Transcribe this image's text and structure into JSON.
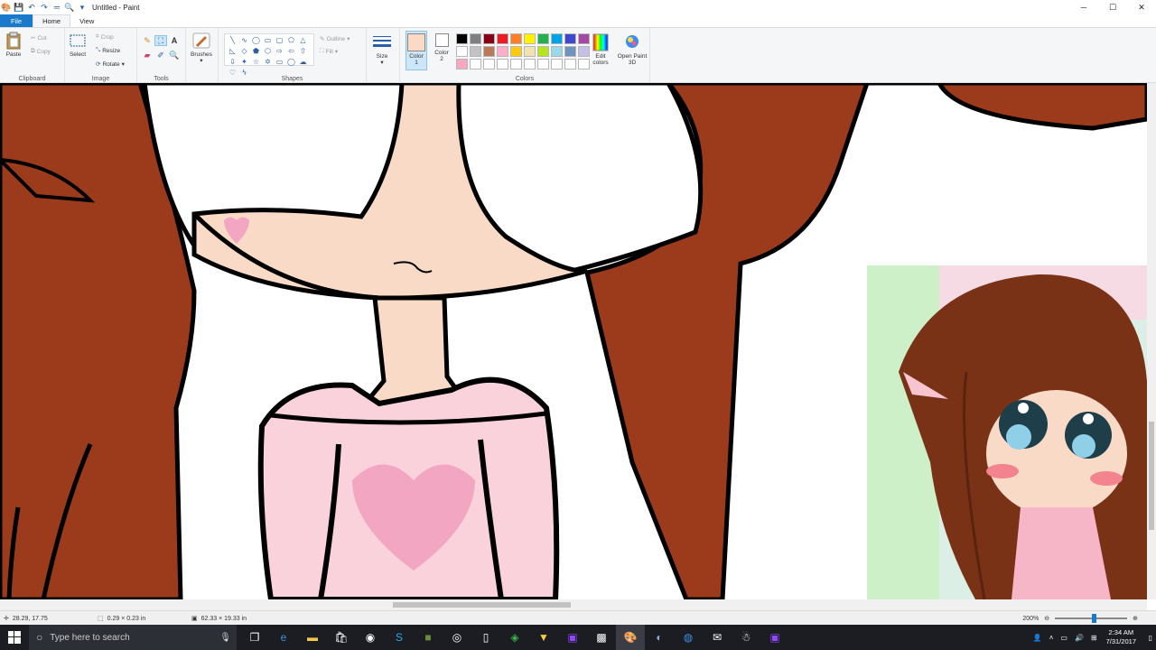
{
  "app": {
    "title": "Untitled - Paint"
  },
  "window_controls": {
    "minimize": "─",
    "maximize": "☐",
    "close": "✕"
  },
  "tabs": [
    {
      "label": "File"
    },
    {
      "label": "Home"
    },
    {
      "label": "View"
    }
  ],
  "clipboard": {
    "paste": "Paste",
    "cut": "Cut",
    "copy": "Copy",
    "group": "Clipboard"
  },
  "image": {
    "select": "Select",
    "crop": "Crop",
    "resize": "Resize",
    "rotate": "Rotate",
    "group": "Image"
  },
  "tools": {
    "group": "Tools"
  },
  "brushes": {
    "label": "Brushes"
  },
  "shapes": {
    "group": "Shapes",
    "outline": "Outline",
    "fill": "Fill"
  },
  "size": {
    "label": "Size"
  },
  "colors": {
    "color1": "Color 1",
    "color2": "Color 2",
    "edit": "Edit colors",
    "paint3d": "Open Paint 3D",
    "group": "Colors",
    "color1_value": "#f9dac6",
    "color2_value": "#ffffff",
    "palette": [
      "#000000",
      "#7f7f7f",
      "#880015",
      "#ed1c24",
      "#ff7f27",
      "#fff200",
      "#22b14c",
      "#00a2e8",
      "#3f48cc",
      "#a349a4",
      "#ffffff",
      "#c3c3c3",
      "#b97a57",
      "#ffaec9",
      "#ffc90e",
      "#efe4b0",
      "#b5e61d",
      "#99d9ea",
      "#7092be",
      "#c8bfe7",
      "#f7a8c0",
      "#ffffff",
      "#ffffff",
      "#ffffff",
      "#ffffff",
      "#ffffff",
      "#ffffff",
      "#ffffff",
      "#ffffff",
      "#ffffff"
    ]
  },
  "status": {
    "cursor": "28.29, 17.75",
    "selection": "0.29 × 0.23 in",
    "image_size": "62.33 × 19.33 in",
    "zoom": "200%",
    "zoom_fraction": 0.55
  },
  "taskbar": {
    "search_placeholder": "Type here to search",
    "time": "2:34 AM",
    "date": "7/31/2017"
  }
}
